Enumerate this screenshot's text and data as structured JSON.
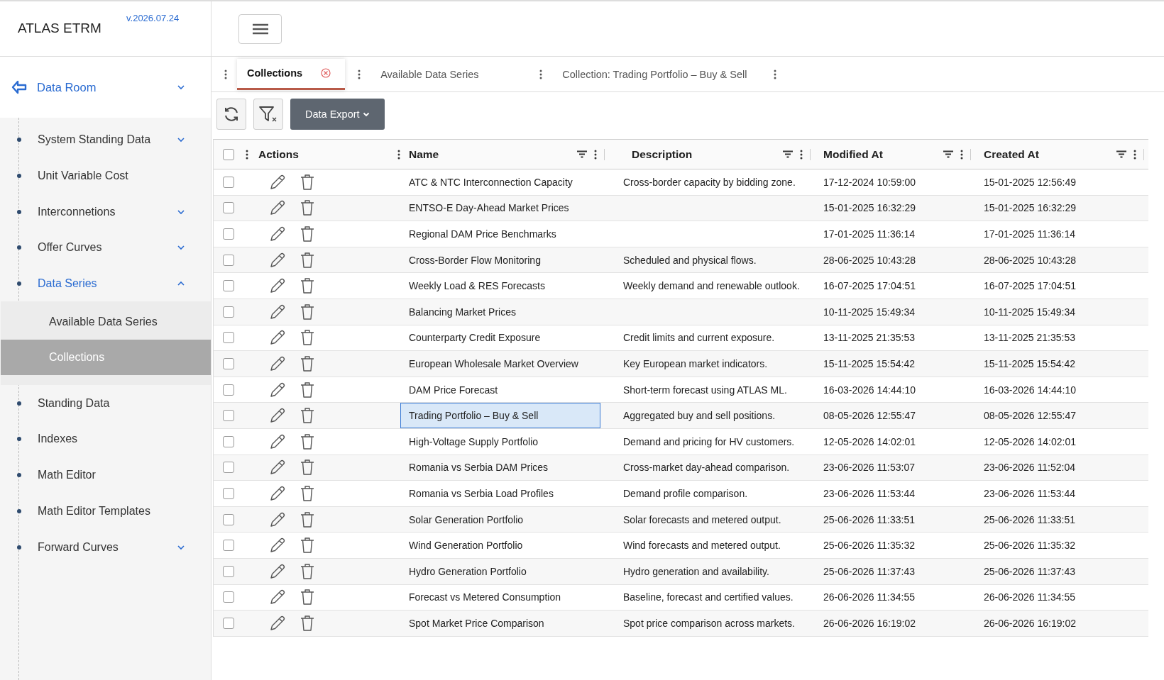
{
  "app": {
    "title": "ATLAS ETRM",
    "version": "v.2026.07.24"
  },
  "sidebar": {
    "section": {
      "label": "Data Room",
      "expanded": true
    },
    "items": [
      {
        "label": "System Standing Data",
        "kind": "group",
        "expanded": false
      },
      {
        "label": "Unit Variable Cost",
        "kind": "link"
      },
      {
        "label": "Interconnetions",
        "kind": "group",
        "expanded": false
      },
      {
        "label": "Offer Curves",
        "kind": "group",
        "expanded": false
      },
      {
        "label": "Data Series",
        "kind": "group",
        "expanded": true,
        "children": [
          {
            "label": "Available Data Series",
            "selected": false
          },
          {
            "label": "Collections",
            "selected": true
          }
        ]
      },
      {
        "label": "Standing Data",
        "kind": "link"
      },
      {
        "label": "Indexes",
        "kind": "link"
      },
      {
        "label": "Math Editor",
        "kind": "link"
      },
      {
        "label": "Math Editor Templates",
        "kind": "link"
      },
      {
        "label": "Forward Curves",
        "kind": "group",
        "expanded": false
      }
    ]
  },
  "tabs": [
    {
      "label": "Collections",
      "selected": true,
      "closable": true
    },
    {
      "label": "Available Data Series",
      "selected": false,
      "closable": false
    },
    {
      "label": "Collection: Trading Portfolio – Buy & Sell",
      "selected": false,
      "closable": false
    }
  ],
  "toolbar": {
    "export_button": "Data Export"
  },
  "table": {
    "all_checked": false,
    "columns": [
      "Actions",
      "Name",
      "Description",
      "Modified At",
      "Created At"
    ],
    "rows": [
      {
        "checked": false,
        "focused": false,
        "name": "ATC & NTC Interconnection Capacity",
        "description": "Cross-border capacity by bidding zone.",
        "modified": "17-12-2024 10:59:00",
        "created": "15-01-2025 12:56:49"
      },
      {
        "checked": false,
        "focused": false,
        "name": "ENTSO-E Day-Ahead Market Prices",
        "description": "",
        "modified": "15-01-2025 16:32:29",
        "created": "15-01-2025 16:32:29"
      },
      {
        "checked": false,
        "focused": false,
        "name": "Regional DAM Price Benchmarks",
        "description": "",
        "modified": "17-01-2025 11:36:14",
        "created": "17-01-2025 11:36:14"
      },
      {
        "checked": false,
        "focused": false,
        "name": "Cross-Border Flow Monitoring",
        "description": "Scheduled and physical flows.",
        "modified": "28-06-2025 10:43:28",
        "created": "28-06-2025 10:43:28"
      },
      {
        "checked": false,
        "focused": false,
        "name": "Weekly Load & RES Forecasts",
        "description": "Weekly demand and renewable outlook.",
        "modified": "16-07-2025 17:04:51",
        "created": "16-07-2025 17:04:51"
      },
      {
        "checked": false,
        "focused": false,
        "name": "Balancing Market Prices",
        "description": "",
        "modified": "10-11-2025 15:49:34",
        "created": "10-11-2025 15:49:34"
      },
      {
        "checked": false,
        "focused": false,
        "name": "Counterparty Credit Exposure",
        "description": "Credit limits and current exposure.",
        "modified": "13-11-2025 21:35:53",
        "created": "13-11-2025 21:35:53"
      },
      {
        "checked": false,
        "focused": false,
        "name": "European Wholesale Market Overview",
        "description": "Key European market indicators.",
        "modified": "15-11-2025 15:54:42",
        "created": "15-11-2025 15:54:42"
      },
      {
        "checked": false,
        "focused": false,
        "name": "DAM Price Forecast",
        "description": "Short-term forecast using ATLAS ML.",
        "modified": "16-03-2026 14:44:10",
        "created": "16-03-2026 14:44:10"
      },
      {
        "checked": false,
        "focused": true,
        "name": "Trading Portfolio – Buy & Sell",
        "description": "Aggregated buy and sell positions.",
        "modified": "08-05-2026 12:55:47",
        "created": "08-05-2026 12:55:47"
      },
      {
        "checked": false,
        "focused": false,
        "name": "High-Voltage Supply Portfolio",
        "description": "Demand and pricing for HV customers.",
        "modified": "12-05-2026 14:02:01",
        "created": "12-05-2026 14:02:01"
      },
      {
        "checked": false,
        "focused": false,
        "name": "Romania vs Serbia DAM Prices",
        "description": "Cross-market day-ahead comparison.",
        "modified": "23-06-2026 11:53:07",
        "created": "23-06-2026 11:52:04"
      },
      {
        "checked": false,
        "focused": false,
        "name": "Romania vs Serbia Load Profiles",
        "description": "Demand profile comparison.",
        "modified": "23-06-2026 11:53:44",
        "created": "23-06-2026 11:53:44"
      },
      {
        "checked": false,
        "focused": false,
        "name": "Solar Generation Portfolio",
        "description": "Solar forecasts and metered output.",
        "modified": "25-06-2026 11:33:51",
        "created": "25-06-2026 11:33:51"
      },
      {
        "checked": false,
        "focused": false,
        "name": "Wind Generation Portfolio",
        "description": "Wind forecasts and metered output.",
        "modified": "25-06-2026 11:35:32",
        "created": "25-06-2026 11:35:32"
      },
      {
        "checked": false,
        "focused": false,
        "name": "Hydro Generation Portfolio",
        "description": "Hydro generation and availability.",
        "modified": "25-06-2026 11:37:43",
        "created": "25-06-2026 11:37:43"
      },
      {
        "checked": false,
        "focused": false,
        "name": "Forecast vs Metered Consumption",
        "description": "Baseline, forecast and certified values.",
        "modified": "26-06-2026 11:34:55",
        "created": "26-06-2026 11:34:55"
      },
      {
        "checked": false,
        "focused": false,
        "name": "Spot Market Price Comparison",
        "description": "Spot price comparison across markets.",
        "modified": "26-06-2026 16:19:02",
        "created": "26-06-2026 16:19:02"
      }
    ]
  }
}
